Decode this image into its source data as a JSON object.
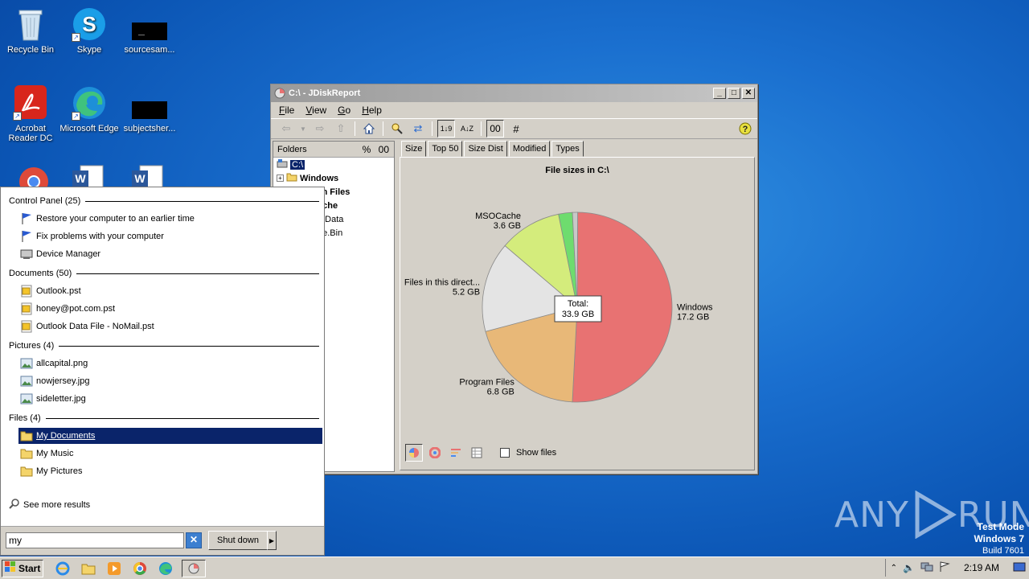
{
  "desktop": {
    "icons": [
      {
        "label": "Recycle Bin",
        "icon": "recycle-bin-icon"
      },
      {
        "label": "Skype",
        "icon": "skype-icon"
      },
      {
        "label": "sourcesam...",
        "icon": "black-file-icon"
      },
      {
        "label": "Acrobat Reader DC",
        "icon": "acrobat-icon"
      },
      {
        "label": "Microsoft Edge",
        "icon": "edge-icon"
      },
      {
        "label": "subjectsher...",
        "icon": "black-file-icon"
      }
    ]
  },
  "jdr": {
    "title": "C:\\ - JDiskReport",
    "menu": [
      "File",
      "View",
      "Go",
      "Help"
    ],
    "toolbar": {
      "sort_size": "1↓9",
      "sort_name": "A↓Z",
      "zero_label": "00",
      "hash_label": "#"
    },
    "folders_header": "Folders",
    "folders_ctrl_pct": "%",
    "folders_ctrl_num": "00",
    "tree": [
      {
        "label": "C:\\",
        "selected": true
      },
      {
        "label": "Windows",
        "bold": true
      },
      {
        "label": "Program Files",
        "bold": true
      },
      {
        "label": "MSOCache",
        "bold": true
      },
      {
        "label": "ProgramData",
        "bold": false
      },
      {
        "label": "$Recycle.Bin",
        "bold": false
      }
    ],
    "tabs": [
      "Size",
      "Top 50",
      "Size Dist",
      "Modified",
      "Types"
    ],
    "active_tab": "Size",
    "show_files_label": "Show files"
  },
  "chart_data": {
    "type": "pie",
    "title": "File sizes in C:\\",
    "center_label": "Total:",
    "center_value": "33.9 GB",
    "slices": [
      {
        "name": "Windows",
        "value": 17.2,
        "value_label": "17.2 GB",
        "color": "#e87272"
      },
      {
        "name": "Program Files",
        "value": 6.8,
        "value_label": "6.8 GB",
        "color": "#e8b878"
      },
      {
        "name": "Files in this direct...",
        "value": 5.2,
        "value_label": "5.2 GB",
        "color": "#e4e4e4"
      },
      {
        "name": "MSOCache",
        "value": 3.6,
        "value_label": "3.6 GB",
        "color": "#d4ec7c"
      },
      {
        "name": "",
        "value": 0.8,
        "value_label": "",
        "color": "#6edc6e"
      },
      {
        "name": "",
        "value": 0.3,
        "value_label": "",
        "color": "#c8c8c8"
      }
    ]
  },
  "start_menu": {
    "groups": [
      {
        "label": "Control Panel (25)",
        "items": [
          {
            "label": "Restore your computer to an earlier time",
            "icon": "flag-icon"
          },
          {
            "label": "Fix problems with your computer",
            "icon": "flag-icon"
          },
          {
            "label": "Device Manager",
            "icon": "device-manager-icon"
          }
        ]
      },
      {
        "label": "Documents (50)",
        "items": [
          {
            "label": "Outlook.pst",
            "icon": "pst-file-icon"
          },
          {
            "label": "honey@pot.com.pst",
            "icon": "pst-file-icon"
          },
          {
            "label": "Outlook Data File - NoMail.pst",
            "icon": "pst-file-icon"
          }
        ]
      },
      {
        "label": "Pictures (4)",
        "items": [
          {
            "label": "allcapital.png",
            "icon": "image-file-icon"
          },
          {
            "label": "nowjersey.jpg",
            "icon": "image-file-icon"
          },
          {
            "label": "sideletter.jpg",
            "icon": "image-file-icon"
          }
        ]
      },
      {
        "label": "Files (4)",
        "items": [
          {
            "label": "My Documents",
            "icon": "folder-icon",
            "selected": true
          },
          {
            "label": "My Music",
            "icon": "folder-icon"
          },
          {
            "label": "My Pictures",
            "icon": "folder-icon"
          }
        ]
      }
    ],
    "see_more": "See more results",
    "search_value": "my",
    "clear_label": "✕",
    "shutdown_label": "Shut down"
  },
  "taskbar": {
    "start_label": "Start",
    "clock": "2:19 AM"
  },
  "watermark": {
    "line1": "Test Mode",
    "line2": "Windows 7",
    "line3": "Build 7601",
    "logo": "ANY RUN"
  }
}
